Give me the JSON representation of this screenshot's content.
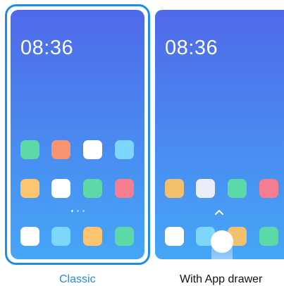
{
  "options": [
    {
      "label": "Classic",
      "selected": true,
      "clock": "08:36",
      "rows": [
        [
          "#5cd9a6",
          "#f7936f",
          "#ffffff",
          "#7dd6fb"
        ],
        [
          "#fdc46f",
          "#ffffff",
          "#5cd9a6",
          "#f57d8f"
        ],
        [
          "#ffffff",
          "#7dd6fb",
          "#fdc46f",
          "#5cd9a6"
        ]
      ]
    },
    {
      "label": "With App drawer",
      "selected": false,
      "clock": "08:36",
      "rows": [
        [
          "#f2c06d",
          "#e9eef8",
          "#5cd9a6",
          "#f57d8f"
        ],
        [
          "#ffffff",
          "#7dd6fb",
          "#f2c06d",
          "#5cd9a6"
        ]
      ]
    }
  ],
  "colors": {
    "accent": "#1d8ee8",
    "wallpaper_top": "#4f69ea",
    "wallpaper_bottom": "#46a6f7"
  },
  "icons": [
    "chevron-up-icon",
    "swipe-up-circle-icon"
  ]
}
